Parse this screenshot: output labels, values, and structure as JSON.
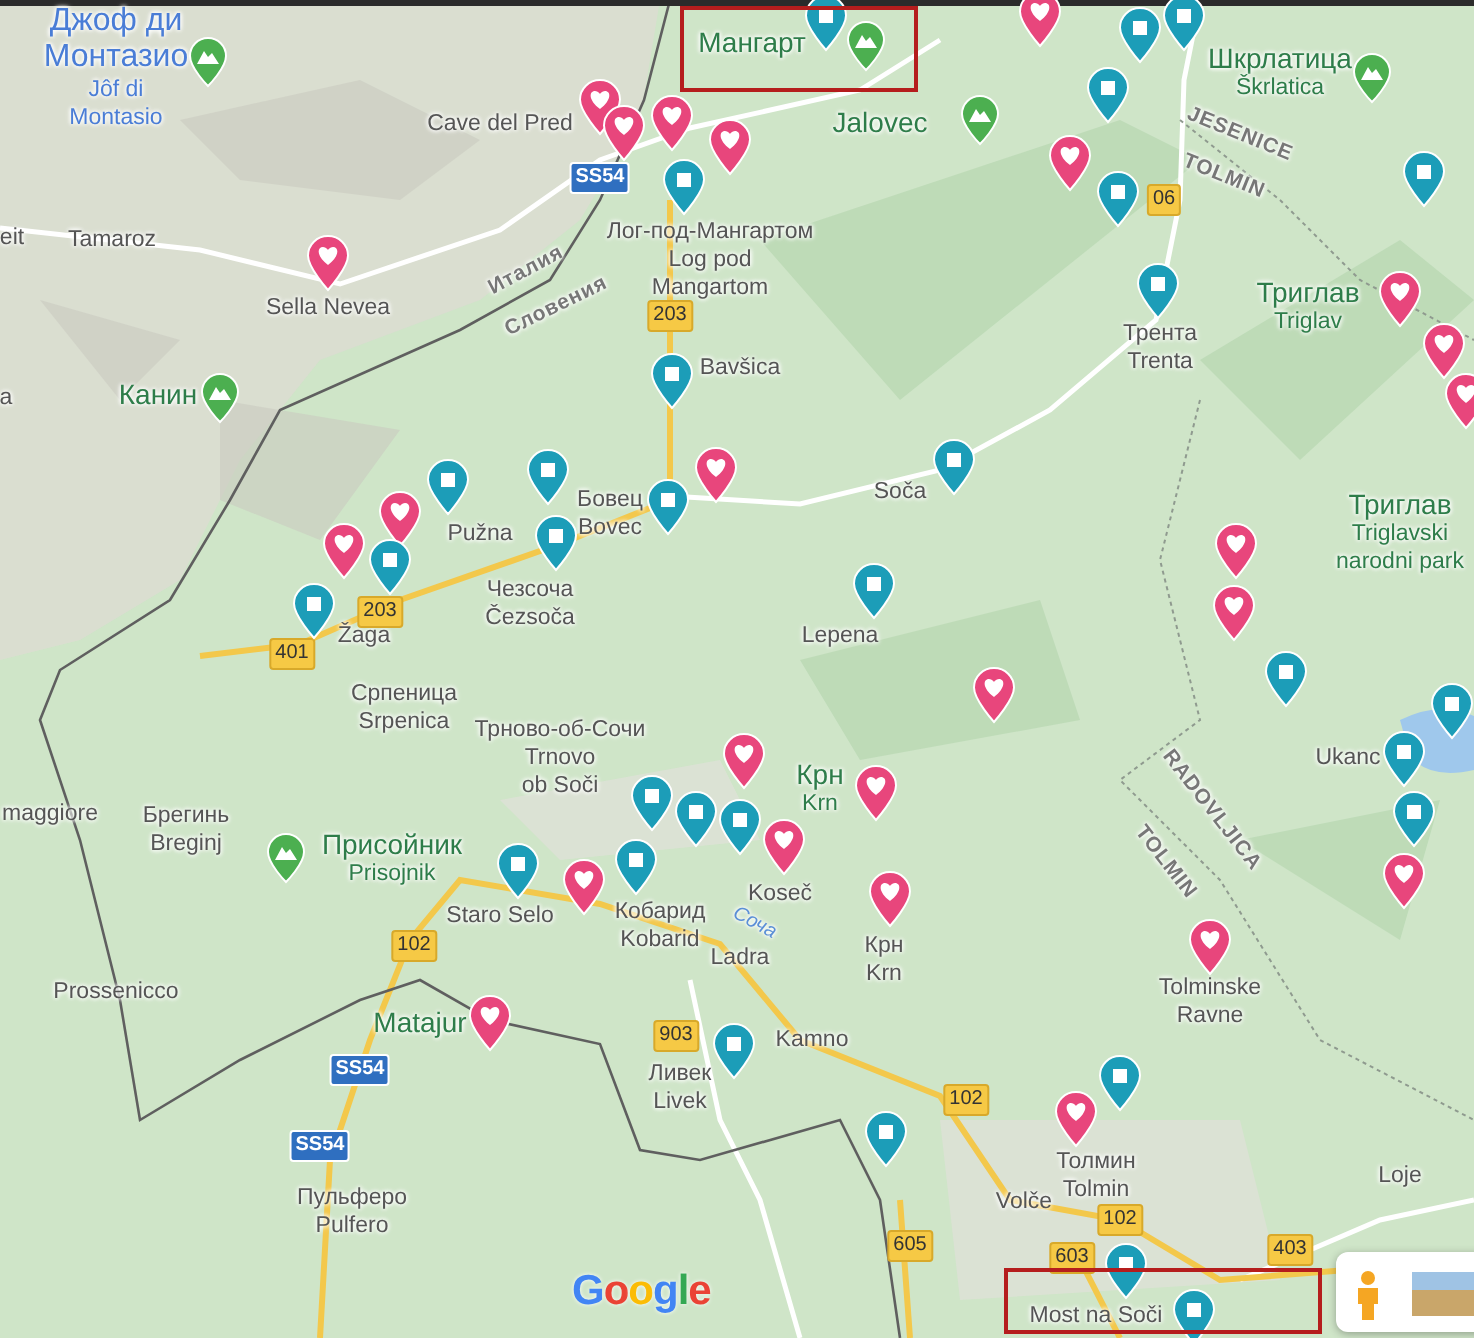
{
  "map": {
    "labels": [
      {
        "kind": "peak",
        "highlighted": true,
        "lines": [
          "Джоф ди",
          "Монтазио"
        ],
        "sub_lines": [
          "Jôf di",
          "Montasio"
        ]
      },
      {
        "kind": "peak",
        "highlighted": false,
        "lines": [
          "Мангарт"
        ]
      },
      {
        "kind": "peak",
        "highlighted": false,
        "lines": [
          "Шкрлатица"
        ],
        "sub_lines": [
          "Škrlatica"
        ]
      },
      {
        "kind": "place",
        "lines": [
          "Cave del Pred"
        ]
      },
      {
        "kind": "peak",
        "highlighted": false,
        "lines": [
          "Jalovec"
        ]
      },
      {
        "kind": "region",
        "lines": [
          "JESENICE"
        ]
      },
      {
        "kind": "region",
        "lines": [
          "TOLMIN"
        ]
      },
      {
        "kind": "place",
        "lines": [
          "eit"
        ]
      },
      {
        "kind": "place",
        "lines": [
          "Tamaroz"
        ]
      },
      {
        "kind": "place",
        "lines": [
          "Лог-под-Мангартом",
          "Log pod",
          "Mangartom"
        ]
      },
      {
        "kind": "place",
        "lines": [
          "Sella Nevea"
        ]
      },
      {
        "kind": "region",
        "lines": [
          "Италия"
        ]
      },
      {
        "kind": "region",
        "lines": [
          "Словения"
        ]
      },
      {
        "kind": "peak",
        "highlighted": false,
        "lines": [
          "Триглав"
        ],
        "sub_lines": [
          "Triglav"
        ]
      },
      {
        "kind": "place",
        "lines": [
          "Bavšica"
        ]
      },
      {
        "kind": "place",
        "lines": [
          "Трента",
          "Trenta"
        ]
      },
      {
        "kind": "place",
        "lines": [
          "a"
        ]
      },
      {
        "kind": "peak",
        "highlighted": false,
        "lines": [
          "Канин"
        ]
      },
      {
        "kind": "place",
        "lines": [
          "Pužna"
        ]
      },
      {
        "kind": "place",
        "lines": [
          "Бовец",
          "Bovec"
        ]
      },
      {
        "kind": "place",
        "lines": [
          "Soča"
        ]
      },
      {
        "kind": "place",
        "lines": [
          "Чезсоча",
          "Čezsoča"
        ]
      },
      {
        "kind": "park",
        "highlighted": false,
        "lines": [
          "Триглав"
        ],
        "sub_lines": [
          "Triglavski",
          "narodni park"
        ]
      },
      {
        "kind": "place",
        "lines": [
          "Žaga"
        ]
      },
      {
        "kind": "place",
        "lines": [
          "Lepena"
        ]
      },
      {
        "kind": "place",
        "lines": [
          "Српеница",
          "Srpenica"
        ]
      },
      {
        "kind": "place",
        "lines": [
          "Трново-об-Сочи",
          "Trnovo",
          "ob Soči"
        ]
      },
      {
        "kind": "place",
        "lines": [
          "Ukanc"
        ]
      },
      {
        "kind": "park",
        "highlighted": false,
        "lines": [
          "Крн"
        ],
        "sub_lines": [
          "Krn"
        ]
      },
      {
        "kind": "region",
        "lines": [
          "RADOVLJICA"
        ]
      },
      {
        "kind": "place",
        "lines": [
          "maggiore"
        ]
      },
      {
        "kind": "place",
        "lines": [
          "Брегинь",
          "Breginj"
        ]
      },
      {
        "kind": "peak",
        "highlighted": false,
        "lines": [
          "Присойник"
        ],
        "sub_lines": [
          "Prisojnik"
        ]
      },
      {
        "kind": "region",
        "lines": [
          "TOLMIN"
        ]
      },
      {
        "kind": "place",
        "lines": [
          "Koseč"
        ]
      },
      {
        "kind": "place",
        "lines": [
          "Staro Selo"
        ]
      },
      {
        "kind": "place",
        "lines": [
          "Кобарид",
          "Kobarid"
        ]
      },
      {
        "kind": "water",
        "lines": [
          "Соча"
        ]
      },
      {
        "kind": "place",
        "lines": [
          "Крн",
          "Krn"
        ]
      },
      {
        "kind": "place",
        "lines": [
          "Ladra"
        ]
      },
      {
        "kind": "place",
        "lines": [
          "Prossenicco"
        ]
      },
      {
        "kind": "place",
        "lines": [
          "Tolminske",
          "Ravne"
        ]
      },
      {
        "kind": "park",
        "highlighted": false,
        "lines": [
          "Matajur"
        ]
      },
      {
        "kind": "place",
        "lines": [
          "Kamno"
        ]
      },
      {
        "kind": "place",
        "lines": [
          "Ливек",
          "Livek"
        ]
      },
      {
        "kind": "place",
        "lines": [
          "Толмин",
          "Tolmin"
        ]
      },
      {
        "kind": "place",
        "lines": [
          "Loje"
        ]
      },
      {
        "kind": "place",
        "lines": [
          "Пульферо",
          "Pulfero"
        ]
      },
      {
        "kind": "place",
        "lines": [
          "Volče"
        ]
      },
      {
        "kind": "place",
        "lines": [
          "Most na Soči"
        ]
      }
    ],
    "road_shields": [
      {
        "kind": "highway",
        "number": "SS54"
      },
      {
        "kind": "road",
        "number": "203"
      },
      {
        "kind": "road",
        "number": "06"
      },
      {
        "kind": "road",
        "number": "203"
      },
      {
        "kind": "road",
        "number": "401"
      },
      {
        "kind": "road",
        "number": "102"
      },
      {
        "kind": "road",
        "number": "903"
      },
      {
        "kind": "highway",
        "number": "SS54"
      },
      {
        "kind": "highway",
        "number": "SS54"
      },
      {
        "kind": "road",
        "number": "102"
      },
      {
        "kind": "road",
        "number": "102"
      },
      {
        "kind": "road",
        "number": "605"
      },
      {
        "kind": "road",
        "number": "603"
      },
      {
        "kind": "road",
        "number": "403"
      }
    ],
    "pins": [
      {
        "kind": "heart"
      },
      {
        "kind": "heart"
      },
      {
        "kind": "heart"
      },
      {
        "kind": "heart"
      },
      {
        "kind": "heart"
      },
      {
        "kind": "heart"
      },
      {
        "kind": "heart"
      },
      {
        "kind": "heart"
      },
      {
        "kind": "heart"
      },
      {
        "kind": "heart"
      },
      {
        "kind": "heart"
      },
      {
        "kind": "heart"
      },
      {
        "kind": "heart"
      },
      {
        "kind": "heart"
      },
      {
        "kind": "heart"
      },
      {
        "kind": "heart"
      },
      {
        "kind": "heart"
      },
      {
        "kind": "heart"
      },
      {
        "kind": "heart"
      },
      {
        "kind": "heart"
      },
      {
        "kind": "heart"
      },
      {
        "kind": "heart"
      },
      {
        "kind": "heart"
      },
      {
        "kind": "heart"
      },
      {
        "kind": "heart"
      },
      {
        "kind": "square"
      },
      {
        "kind": "square"
      },
      {
        "kind": "square"
      },
      {
        "kind": "square"
      },
      {
        "kind": "square"
      },
      {
        "kind": "square"
      },
      {
        "kind": "square"
      },
      {
        "kind": "square"
      },
      {
        "kind": "square"
      },
      {
        "kind": "square"
      },
      {
        "kind": "square"
      },
      {
        "kind": "square"
      },
      {
        "kind": "square"
      },
      {
        "kind": "square"
      },
      {
        "kind": "square"
      },
      {
        "kind": "square"
      },
      {
        "kind": "square"
      },
      {
        "kind": "square"
      },
      {
        "kind": "square"
      },
      {
        "kind": "square"
      },
      {
        "kind": "square"
      },
      {
        "kind": "square"
      },
      {
        "kind": "square"
      },
      {
        "kind": "square"
      },
      {
        "kind": "square"
      },
      {
        "kind": "square"
      },
      {
        "kind": "square"
      },
      {
        "kind": "square"
      },
      {
        "kind": "square"
      },
      {
        "kind": "square"
      },
      {
        "kind": "square"
      }
    ],
    "logo": "Google"
  }
}
